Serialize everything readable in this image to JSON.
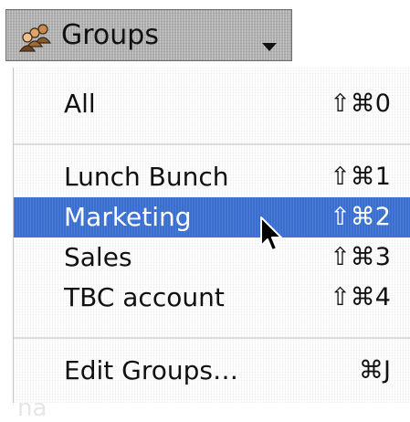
{
  "popup": {
    "label": "Groups",
    "icon": "groups-icon",
    "arrow_icon": "chevron-down-icon"
  },
  "menu": {
    "items": [
      {
        "label": "All",
        "shortcut": "⇧⌘0",
        "selected": false
      },
      {
        "label": "Lunch Bunch",
        "shortcut": "⇧⌘1",
        "selected": false
      },
      {
        "label": "Marketing",
        "shortcut": "⇧⌘2",
        "selected": true
      },
      {
        "label": "Sales",
        "shortcut": "⇧⌘3",
        "selected": false
      },
      {
        "label": "TBC account",
        "shortcut": "⇧⌘4",
        "selected": false
      },
      {
        "label": "Edit Groups…",
        "shortcut": "⌘J",
        "selected": false
      }
    ]
  },
  "colors": {
    "selection": "#3a6fd0",
    "popup_bg": "#b0b0b0"
  },
  "cursor_icon": "arrow-pointer-icon"
}
